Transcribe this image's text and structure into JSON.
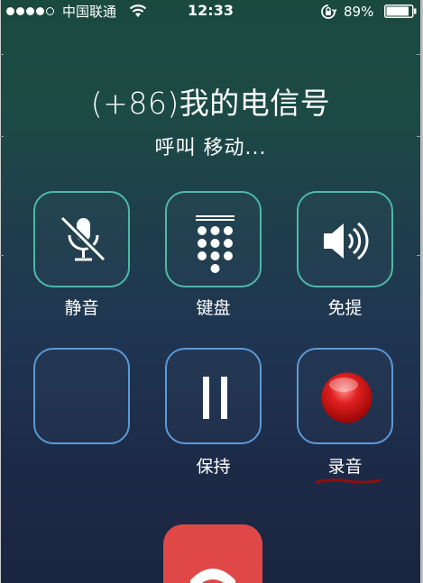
{
  "status_bar": {
    "carrier": "中国联通",
    "time": "12:33",
    "battery": "89%",
    "signal_bars_filled": 4,
    "signal_bars_total": 5,
    "battery_level": 0.89
  },
  "call": {
    "caller": "(+86)我的电信号",
    "status": "呼叫 移动..."
  },
  "buttons": {
    "mute": {
      "label": "静音",
      "icon": "mic-muted-icon"
    },
    "keypad": {
      "label": "键盘",
      "icon": "keypad-icon"
    },
    "speaker": {
      "label": "免提",
      "icon": "speaker-icon"
    },
    "blank": {
      "label": ""
    },
    "hold": {
      "label": "保持",
      "icon": "pause-icon"
    },
    "record": {
      "label": "录音",
      "icon": "record-icon"
    }
  },
  "end_call": {
    "icon": "phone-hangup-icon"
  },
  "colors": {
    "top_button_border": "#4fb8a8",
    "bottom_button_border": "#5b9ad6",
    "end_call": "#e04848",
    "record_dot": "#d81818",
    "annotation_underline": "#8b1010"
  }
}
